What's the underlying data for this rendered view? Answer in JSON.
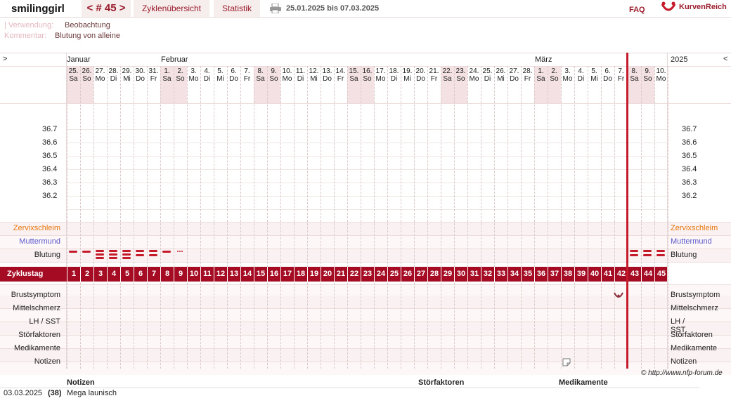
{
  "header": {
    "user": "smilinggirl",
    "cycle_nav": "< # 45 >",
    "tabs": [
      "Zyklenübersicht",
      "Statistik"
    ],
    "date_range": "25.01.2025 bis 07.03.2025",
    "faq": "FAQ",
    "brand": "KurvenReich"
  },
  "meta": {
    "usage_label": "| Verwendung:",
    "usage_value": "Beobachtung",
    "comment_label": "Kommentar:",
    "comment_value": "Blutung von alleine"
  },
  "grid": {
    "left_arrow": ">",
    "right_arrow": "<",
    "year": "2025",
    "months": [
      "Januar",
      "Februar",
      "März"
    ],
    "days": [
      {
        "d": "25.",
        "w": "Sa"
      },
      {
        "d": "26.",
        "w": "So"
      },
      {
        "d": "27.",
        "w": "Mo"
      },
      {
        "d": "28.",
        "w": "Di"
      },
      {
        "d": "29.",
        "w": "Mi"
      },
      {
        "d": "30.",
        "w": "Do"
      },
      {
        "d": "31.",
        "w": "Fr"
      },
      {
        "d": "1.",
        "w": "Sa"
      },
      {
        "d": "2.",
        "w": "So"
      },
      {
        "d": "3.",
        "w": "Mo"
      },
      {
        "d": "4.",
        "w": "Di"
      },
      {
        "d": "5.",
        "w": "Mi"
      },
      {
        "d": "6.",
        "w": "Do"
      },
      {
        "d": "7.",
        "w": "Fr"
      },
      {
        "d": "8.",
        "w": "Sa"
      },
      {
        "d": "9.",
        "w": "So"
      },
      {
        "d": "10.",
        "w": "Mo"
      },
      {
        "d": "11.",
        "w": "Di"
      },
      {
        "d": "12.",
        "w": "Mi"
      },
      {
        "d": "13.",
        "w": "Do"
      },
      {
        "d": "14.",
        "w": "Fr"
      },
      {
        "d": "15.",
        "w": "Sa"
      },
      {
        "d": "16.",
        "w": "So"
      },
      {
        "d": "17.",
        "w": "Mo"
      },
      {
        "d": "18.",
        "w": "Di"
      },
      {
        "d": "19.",
        "w": "Mi"
      },
      {
        "d": "20.",
        "w": "Do"
      },
      {
        "d": "21.",
        "w": "Fr"
      },
      {
        "d": "22.",
        "w": "Sa"
      },
      {
        "d": "23.",
        "w": "So"
      },
      {
        "d": "24.",
        "w": "Mo"
      },
      {
        "d": "25.",
        "w": "Di"
      },
      {
        "d": "26.",
        "w": "Mi"
      },
      {
        "d": "27.",
        "w": "Do"
      },
      {
        "d": "28.",
        "w": "Fr"
      },
      {
        "d": "1.",
        "w": "Sa"
      },
      {
        "d": "2.",
        "w": "So"
      },
      {
        "d": "3.",
        "w": "Mo"
      },
      {
        "d": "4.",
        "w": "Di"
      },
      {
        "d": "5.",
        "w": "Mi"
      },
      {
        "d": "6.",
        "w": "Do"
      },
      {
        "d": "7.",
        "w": "Fr"
      },
      {
        "d": "8.",
        "w": "Sa"
      },
      {
        "d": "9.",
        "w": "So"
      },
      {
        "d": "10.",
        "w": "Mo"
      }
    ],
    "temps": [
      "36.7",
      "36.6",
      "36.5",
      "36.4",
      "36.3",
      "36.2"
    ],
    "rows_top": [
      "Zervixschleim",
      "Muttermund",
      "Blutung"
    ],
    "zyklustag_label": "Zyklustag",
    "cycle_days": [
      1,
      2,
      3,
      4,
      5,
      6,
      7,
      8,
      9,
      10,
      11,
      12,
      13,
      14,
      15,
      16,
      17,
      18,
      19,
      20,
      21,
      22,
      23,
      24,
      25,
      26,
      27,
      28,
      29,
      30,
      31,
      32,
      33,
      34,
      35,
      36,
      37,
      38,
      39,
      40,
      41,
      42,
      43,
      44,
      45
    ],
    "rows_bottom": [
      "Brustsymptom",
      "Mittelschmerz",
      "LH / SST",
      "Störfaktoren",
      "Medikamente",
      "Notizen"
    ],
    "copyright": "© http://www.nfp-forum.de"
  },
  "bleeding": [
    {
      "day": 1,
      "level": 1
    },
    {
      "day": 2,
      "level": 1
    },
    {
      "day": 3,
      "level": 3
    },
    {
      "day": 4,
      "level": 3
    },
    {
      "day": 5,
      "level": 3
    },
    {
      "day": 6,
      "level": 2
    },
    {
      "day": 7,
      "level": 2
    },
    {
      "day": 8,
      "level": 1
    },
    {
      "day": 9,
      "level": 0
    },
    {
      "day": 43,
      "level": 2
    },
    {
      "day": 44,
      "level": 2
    },
    {
      "day": 45,
      "level": 2
    }
  ],
  "notes_table": {
    "headers": [
      "Notizen",
      "Störfaktoren",
      "Medikamente"
    ],
    "rows": [
      {
        "date": "03.03.2025",
        "cycleday": "(38)",
        "note": "Mega launisch"
      }
    ]
  },
  "colors": {
    "accent": "#a50c24",
    "cervix": "#e8750a",
    "mouth": "#5a5acc",
    "weekend": "#f3e1e3"
  }
}
